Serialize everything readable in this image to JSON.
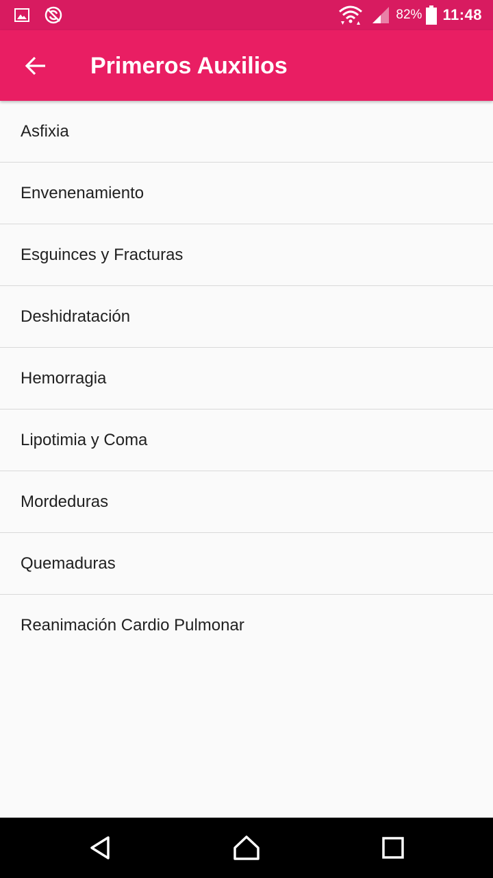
{
  "status_bar": {
    "left_icons": [
      "image-icon",
      "no-sync-icon"
    ],
    "right_icons": [
      "wifi-icon",
      "signal-icon",
      "battery-icon"
    ],
    "battery": "82%",
    "time": "11:48"
  },
  "app_bar": {
    "title": "Primeros Auxilios",
    "back_icon": "arrow-back-icon"
  },
  "list": {
    "items": [
      "Asfixia",
      "Envenenamiento",
      "Esguinces y Fracturas",
      "Deshidratación",
      "Hemorragia",
      "Lipotimia y Coma",
      "Mordeduras",
      "Quemaduras",
      "Reanimación Cardio Pulmonar"
    ]
  },
  "nav_bar": {
    "icons": [
      "back-triangle-icon",
      "home-icon",
      "recents-icon"
    ]
  },
  "colors": {
    "status_bar": "#d81b60",
    "app_bar": "#e91e63",
    "background": "#fafafa",
    "text": "#212121",
    "divider": "#d9d9d9",
    "nav_bar": "#000000"
  }
}
